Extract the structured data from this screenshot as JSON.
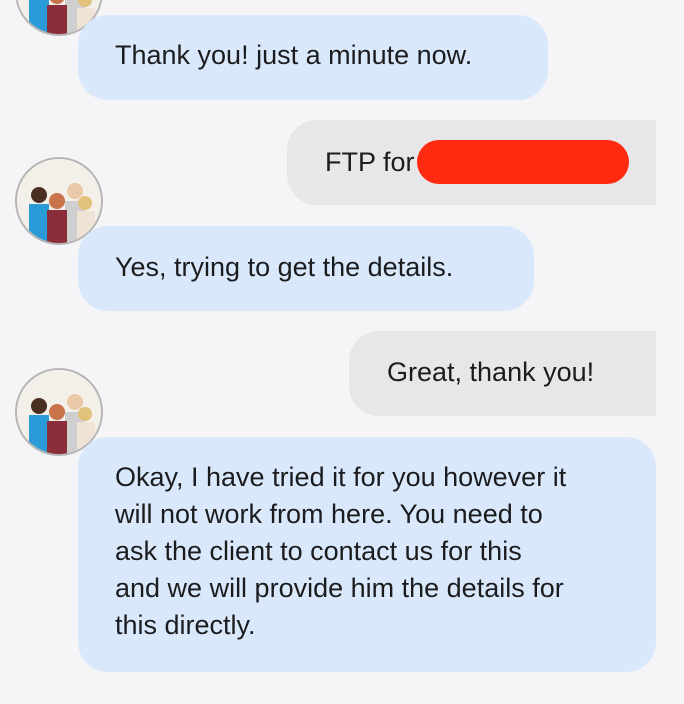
{
  "conversation": {
    "messages": [
      {
        "sender": "agent",
        "text": "Thank you! just a minute now."
      },
      {
        "sender": "user",
        "text": "FTP for",
        "redacted": true
      },
      {
        "sender": "agent",
        "text": "Yes, trying to get the details."
      },
      {
        "sender": "user",
        "text": "Great, thank you!"
      },
      {
        "sender": "agent",
        "lines": [
          "Okay, I have tried it for you however it",
          "will not work from here. You need to",
          "ask the client to contact us for this",
          "and we will provide him the details for",
          "this directly."
        ]
      }
    ]
  },
  "colors": {
    "agent_bubble": "#d9e9fb",
    "user_bubble": "#e7e7e9",
    "redaction": "#ff2a10",
    "background": "#f5f5f7"
  }
}
